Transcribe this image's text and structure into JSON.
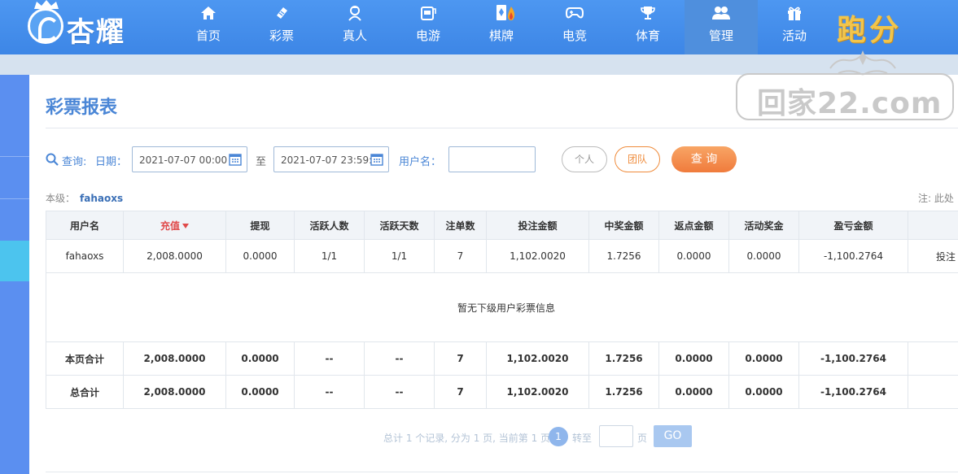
{
  "brand": {
    "name": "杏耀",
    "promo": "跑分"
  },
  "nav": [
    {
      "label": "首页",
      "icon": "home-icon"
    },
    {
      "label": "彩票",
      "icon": "lottery-ticket-icon"
    },
    {
      "label": "真人",
      "icon": "live-dealer-icon"
    },
    {
      "label": "电游",
      "icon": "slot-machine-icon"
    },
    {
      "label": "棋牌",
      "icon": "playing-card-icon"
    },
    {
      "label": "电竞",
      "icon": "gamepad-icon"
    },
    {
      "label": "体育",
      "icon": "trophy-icon"
    },
    {
      "label": "管理",
      "icon": "users-icon",
      "active": true
    },
    {
      "label": "活动",
      "icon": "gift-icon"
    }
  ],
  "watermark": "回家22.com",
  "page": {
    "title": "彩票报表"
  },
  "query": {
    "label": "查询:",
    "date_label": "日期：",
    "start_date": "2021-07-07 00:00",
    "separator": "至",
    "end_date": "2021-07-07 23:59:",
    "username_label": "用户名：",
    "username_value": "",
    "personal_label": "个人",
    "team_label": "团队",
    "query_button": "查 询"
  },
  "level": {
    "label": "本级：",
    "user": "fahaoxs"
  },
  "note": "注: 此处",
  "table": {
    "headers": [
      "用户名",
      "充值",
      "提现",
      "活跃人数",
      "活跃天数",
      "注单数",
      "投注金额",
      "中奖金额",
      "返点金额",
      "活动奖金",
      "盈亏金额",
      ""
    ],
    "row": [
      "fahaoxs",
      "2,008.0000",
      "0.0000",
      "1/1",
      "1/1",
      "7",
      "1,102.0020",
      "1.7256",
      "0.0000",
      "0.0000",
      "-1,100.2764",
      "投注"
    ],
    "empty_message": "暂无下级用户彩票信息",
    "page_total": [
      "本页合计",
      "2,008.0000",
      "0.0000",
      "--",
      "--",
      "7",
      "1,102.0020",
      "1.7256",
      "0.0000",
      "0.0000",
      "-1,100.2764",
      ""
    ],
    "grand_total": [
      "总合计",
      "2,008.0000",
      "0.0000",
      "--",
      "--",
      "7",
      "1,102.0020",
      "1.7256",
      "0.0000",
      "0.0000",
      "-1,100.2764",
      ""
    ]
  },
  "pager": {
    "summary": "总计 1 个记录, 分为 1 页, 当前第 1 页",
    "current": "1",
    "goto_label": "转至",
    "page_unit": "页",
    "go_label": "GO"
  },
  "colors": {
    "header_blue": "#3d86e6",
    "accent_orange": "#f07b3c",
    "negative_red": "#d23a3a",
    "title_blue": "#4a86d6"
  }
}
